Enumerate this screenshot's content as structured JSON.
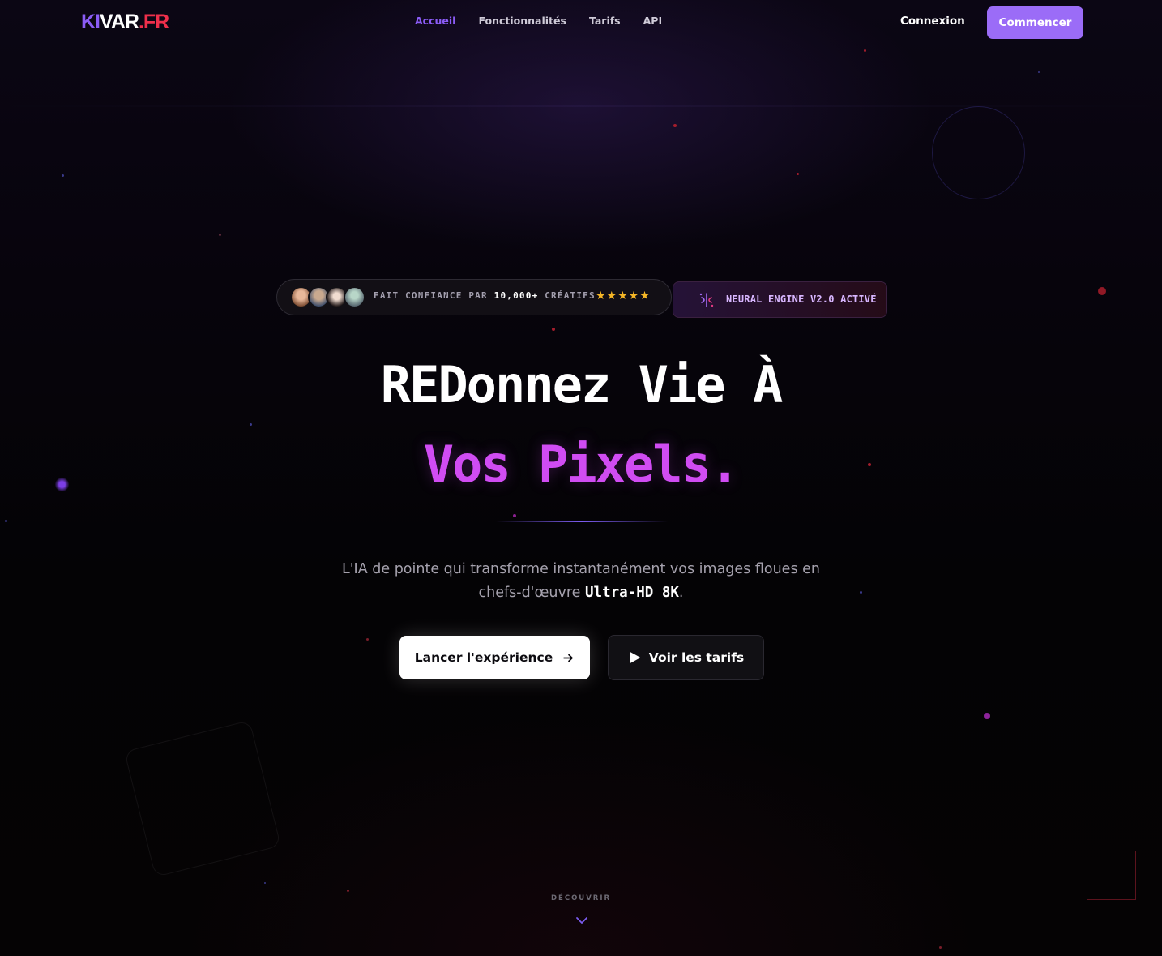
{
  "brand": {
    "ki": "KI",
    "var": "VAR",
    "fr": ".FR"
  },
  "nav": {
    "links": [
      {
        "label": "Accueil",
        "active": true
      },
      {
        "label": "Fonctionnalités",
        "active": false
      },
      {
        "label": "Tarifs",
        "active": false
      },
      {
        "label": "API",
        "active": false
      }
    ],
    "login_label": "Connexion",
    "start_label": "Commencer"
  },
  "trust_badge": {
    "prefix": "FAIT CONFIANCE PAR",
    "count": "10,000+",
    "suffix": "CRÉATIFS",
    "stars": "★★★★★",
    "rating_stars": 5
  },
  "engine_badge": {
    "label": "NEURAL ENGINE V2.0 ACTIVÉ",
    "icon": "ai-sparkle-icon"
  },
  "hero": {
    "line1": "REDonnez Vie À",
    "line2": "Vos Pixels.",
    "lead_line1": "L'IA de pointe qui transforme instantanément vos images floues en",
    "lead_line2_prefix": "chefs-d'œuvre",
    "lead_highlight": "Ultra-HD 8K",
    "lead_line2_suffix": "."
  },
  "cta": {
    "primary_label": "Lancer l'expérience",
    "secondary_label": "Voir les tarifs"
  },
  "discover_label": "DÉCOUVRIR",
  "colors": {
    "accent": "#9b6cf7",
    "active_link": "#8b5cf6",
    "headline_accent": "#d04cf2",
    "brand_red": "#ef2f4b",
    "stars": "#f5b626",
    "background": "#050308"
  }
}
